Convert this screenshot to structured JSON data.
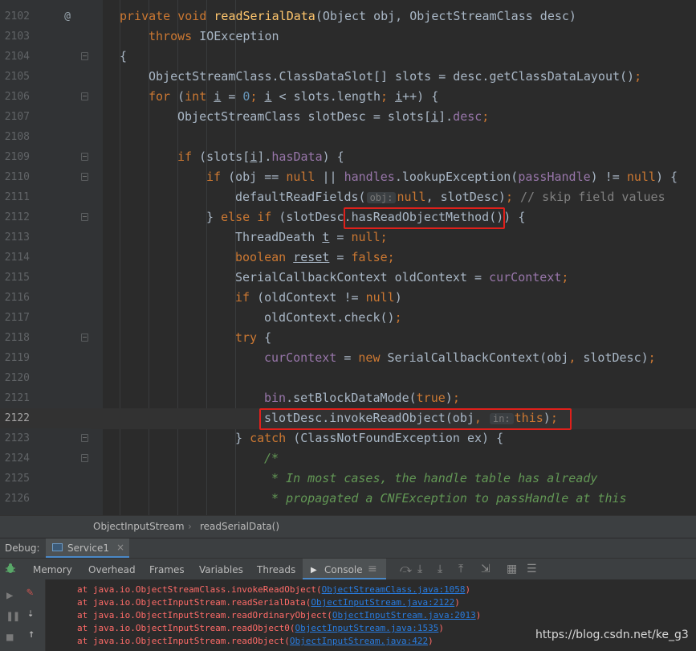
{
  "editor": {
    "lines": [
      {
        "num": "2102",
        "marker": "@",
        "fold": false,
        "indent": 1,
        "tokens": [
          [
            "kw",
            "private void "
          ],
          [
            "fn",
            "readSerialData"
          ],
          [
            "p",
            "(Object obj, ObjectStreamClass desc)"
          ]
        ]
      },
      {
        "num": "2103",
        "marker": "",
        "fold": false,
        "indent": 2,
        "tokens": [
          [
            "kw",
            "throws "
          ],
          [
            "p",
            "IOException"
          ]
        ]
      },
      {
        "num": "2104",
        "marker": "",
        "fold": true,
        "indent": 1,
        "tokens": [
          [
            "p",
            "{"
          ]
        ]
      },
      {
        "num": "2105",
        "marker": "",
        "fold": false,
        "indent": 2,
        "tokens": [
          [
            "p",
            "ObjectStreamClass.ClassDataSlot[] slots = desc.getClassDataLayout()"
          ],
          [
            "kw",
            ";"
          ]
        ]
      },
      {
        "num": "2106",
        "marker": "",
        "fold": true,
        "indent": 2,
        "tokens": [
          [
            "kw",
            "for "
          ],
          [
            "p",
            "("
          ],
          [
            "kw",
            "int "
          ],
          [
            "var",
            "i"
          ],
          [
            "p",
            " = "
          ],
          [
            "num",
            "0"
          ],
          [
            "kw",
            "; "
          ],
          [
            "var",
            "i"
          ],
          [
            "p",
            " < slots.length"
          ],
          [
            "kw",
            "; "
          ],
          [
            "var",
            "i"
          ],
          [
            "p",
            "++) {"
          ]
        ]
      },
      {
        "num": "2107",
        "marker": "",
        "fold": false,
        "indent": 3,
        "tokens": [
          [
            "p",
            "ObjectStreamClass slotDesc = slots["
          ],
          [
            "var",
            "i"
          ],
          [
            "p",
            "]."
          ],
          [
            "fld",
            "desc"
          ],
          [
            "kw",
            ";"
          ]
        ]
      },
      {
        "num": "2108",
        "marker": "",
        "fold": false,
        "indent": 0,
        "tokens": []
      },
      {
        "num": "2109",
        "marker": "",
        "fold": true,
        "indent": 3,
        "tokens": [
          [
            "kw",
            "if "
          ],
          [
            "p",
            "(slots["
          ],
          [
            "var",
            "i"
          ],
          [
            "p",
            "]."
          ],
          [
            "fld",
            "hasData"
          ],
          [
            "p",
            ") {"
          ]
        ]
      },
      {
        "num": "2110",
        "marker": "",
        "fold": true,
        "indent": 4,
        "tokens": [
          [
            "kw",
            "if "
          ],
          [
            "p",
            "(obj == "
          ],
          [
            "kw",
            "null "
          ],
          [
            "p",
            "|| "
          ],
          [
            "fld",
            "handles"
          ],
          [
            "p",
            ".lookupException("
          ],
          [
            "fld",
            "passHandle"
          ],
          [
            "p",
            ") != "
          ],
          [
            "kw",
            "null"
          ],
          [
            "p",
            ") {"
          ]
        ]
      },
      {
        "num": "2111",
        "marker": "",
        "fold": false,
        "indent": 5,
        "tokens": [
          [
            "p",
            "defaultReadFields("
          ],
          [
            "hint",
            "obj:"
          ],
          [
            "kw",
            "null"
          ],
          [
            "p",
            ", slotDesc)"
          ],
          [
            "kw",
            "; "
          ],
          [
            "cmt",
            "// skip field values"
          ]
        ]
      },
      {
        "num": "2112",
        "marker": "",
        "fold": true,
        "indent": 4,
        "tokens": [
          [
            "p",
            "} "
          ],
          [
            "kw",
            "else if "
          ],
          [
            "p",
            "(slotDesc.hasReadObjectMethod()) {"
          ]
        ]
      },
      {
        "num": "2113",
        "marker": "",
        "fold": false,
        "indent": 5,
        "tokens": [
          [
            "p",
            "ThreadDeath "
          ],
          [
            "var",
            "t"
          ],
          [
            "p",
            " = "
          ],
          [
            "kw",
            "null;"
          ]
        ]
      },
      {
        "num": "2114",
        "marker": "",
        "fold": false,
        "indent": 5,
        "tokens": [
          [
            "kw",
            "boolean "
          ],
          [
            "var",
            "reset"
          ],
          [
            "p",
            " = "
          ],
          [
            "kw",
            "false;"
          ]
        ]
      },
      {
        "num": "2115",
        "marker": "",
        "fold": false,
        "indent": 5,
        "tokens": [
          [
            "p",
            "SerialCallbackContext oldContext = "
          ],
          [
            "fld",
            "curContext"
          ],
          [
            "kw",
            ";"
          ]
        ]
      },
      {
        "num": "2116",
        "marker": "",
        "fold": false,
        "indent": 5,
        "tokens": [
          [
            "kw",
            "if "
          ],
          [
            "p",
            "(oldContext != "
          ],
          [
            "kw",
            "null"
          ],
          [
            "p",
            ")"
          ]
        ]
      },
      {
        "num": "2117",
        "marker": "",
        "fold": false,
        "indent": 6,
        "tokens": [
          [
            "p",
            "oldContext.check()"
          ],
          [
            "kw",
            ";"
          ]
        ]
      },
      {
        "num": "2118",
        "marker": "",
        "fold": true,
        "indent": 5,
        "tokens": [
          [
            "kw",
            "try "
          ],
          [
            "p",
            "{"
          ]
        ]
      },
      {
        "num": "2119",
        "marker": "",
        "fold": false,
        "indent": 6,
        "tokens": [
          [
            "fld",
            "curContext"
          ],
          [
            "p",
            " = "
          ],
          [
            "kw",
            "new "
          ],
          [
            "p",
            "SerialCallbackContext(obj"
          ],
          [
            "kw",
            ", "
          ],
          [
            "p",
            "slotDesc)"
          ],
          [
            "kw",
            ";"
          ]
        ]
      },
      {
        "num": "2120",
        "marker": "",
        "fold": false,
        "indent": 0,
        "tokens": []
      },
      {
        "num": "2121",
        "marker": "",
        "fold": false,
        "indent": 6,
        "tokens": [
          [
            "fld",
            "bin"
          ],
          [
            "p",
            ".setBlockDataMode("
          ],
          [
            "kw",
            "true"
          ],
          [
            "p",
            ")"
          ],
          [
            "kw",
            ";"
          ]
        ]
      },
      {
        "num": "2122",
        "marker": "",
        "fold": false,
        "indent": 6,
        "current": true,
        "tokens": [
          [
            "p",
            "slotDesc.invokeReadObject(obj"
          ],
          [
            "kw",
            ", "
          ],
          [
            "hint",
            "in:"
          ],
          [
            "kw",
            "this"
          ],
          [
            "p",
            ")"
          ],
          [
            "kw",
            ";"
          ]
        ]
      },
      {
        "num": "2123",
        "marker": "",
        "fold": true,
        "indent": 5,
        "tokens": [
          [
            "p",
            "} "
          ],
          [
            "kw",
            "catch "
          ],
          [
            "p",
            "(ClassNotFoundException ex) {"
          ]
        ]
      },
      {
        "num": "2124",
        "marker": "",
        "fold": true,
        "indent": 6,
        "tokens": [
          [
            "doc",
            "/*"
          ]
        ]
      },
      {
        "num": "2125",
        "marker": "",
        "fold": false,
        "indent": 6,
        "tokens": [
          [
            "doc",
            " * In most cases, the handle table has already"
          ]
        ]
      },
      {
        "num": "2126",
        "marker": "",
        "fold": false,
        "indent": 6,
        "tokens": [
          [
            "doc",
            " * propagated a CNFException to passHandle at this"
          ]
        ]
      }
    ]
  },
  "breadcrumbs": [
    "ObjectInputStream",
    "readSerialData()"
  ],
  "debug": {
    "label": "Debug:",
    "session_tab": "Service1",
    "close_glyph": "×",
    "tabs": [
      "Memory",
      "Overhead",
      "Frames",
      "Variables",
      "Threads"
    ],
    "console_tab": "Console"
  },
  "console": {
    "lines": [
      {
        "prefix": "at java.io.ObjectStreamClass.invokeReadObject(",
        "link": "ObjectStreamClass.java:1058",
        "suffix": ")"
      },
      {
        "prefix": "at java.io.ObjectInputStream.readSerialData(",
        "link": "ObjectInputStream.java:2122",
        "suffix": ")"
      },
      {
        "prefix": "at java.io.ObjectInputStream.readOrdinaryObject(",
        "link": "ObjectInputStream.java:2013",
        "suffix": ")"
      },
      {
        "prefix": "at java.io.ObjectInputStream.readObject0(",
        "link": "ObjectInputStream.java:1535",
        "suffix": ")"
      },
      {
        "prefix": "at java.io.ObjectInputStream.readObject(",
        "link": "ObjectInputStream.java:422",
        "suffix": ")"
      }
    ]
  },
  "watermark": "https://blog.csdn.net/ke_g3",
  "colors": {
    "keyword": "#cc7832",
    "method": "#ffc66d",
    "field": "#9876aa",
    "number": "#6897bb",
    "text": "#a9b7c6",
    "highlight_box": "#e0201b",
    "error_text": "#ff6b68",
    "link": "#287bde"
  },
  "icons": [
    "bug-icon",
    "service-icon",
    "close-icon",
    "console-icon",
    "show-execution-point-icon",
    "step-over-icon",
    "step-into-icon",
    "force-step-into-icon",
    "step-out-icon",
    "evaluate-icon",
    "resume-icon",
    "pause-icon",
    "restore-layout-icon",
    "up-arrow-icon",
    "breakpoint-edit-icon"
  ]
}
